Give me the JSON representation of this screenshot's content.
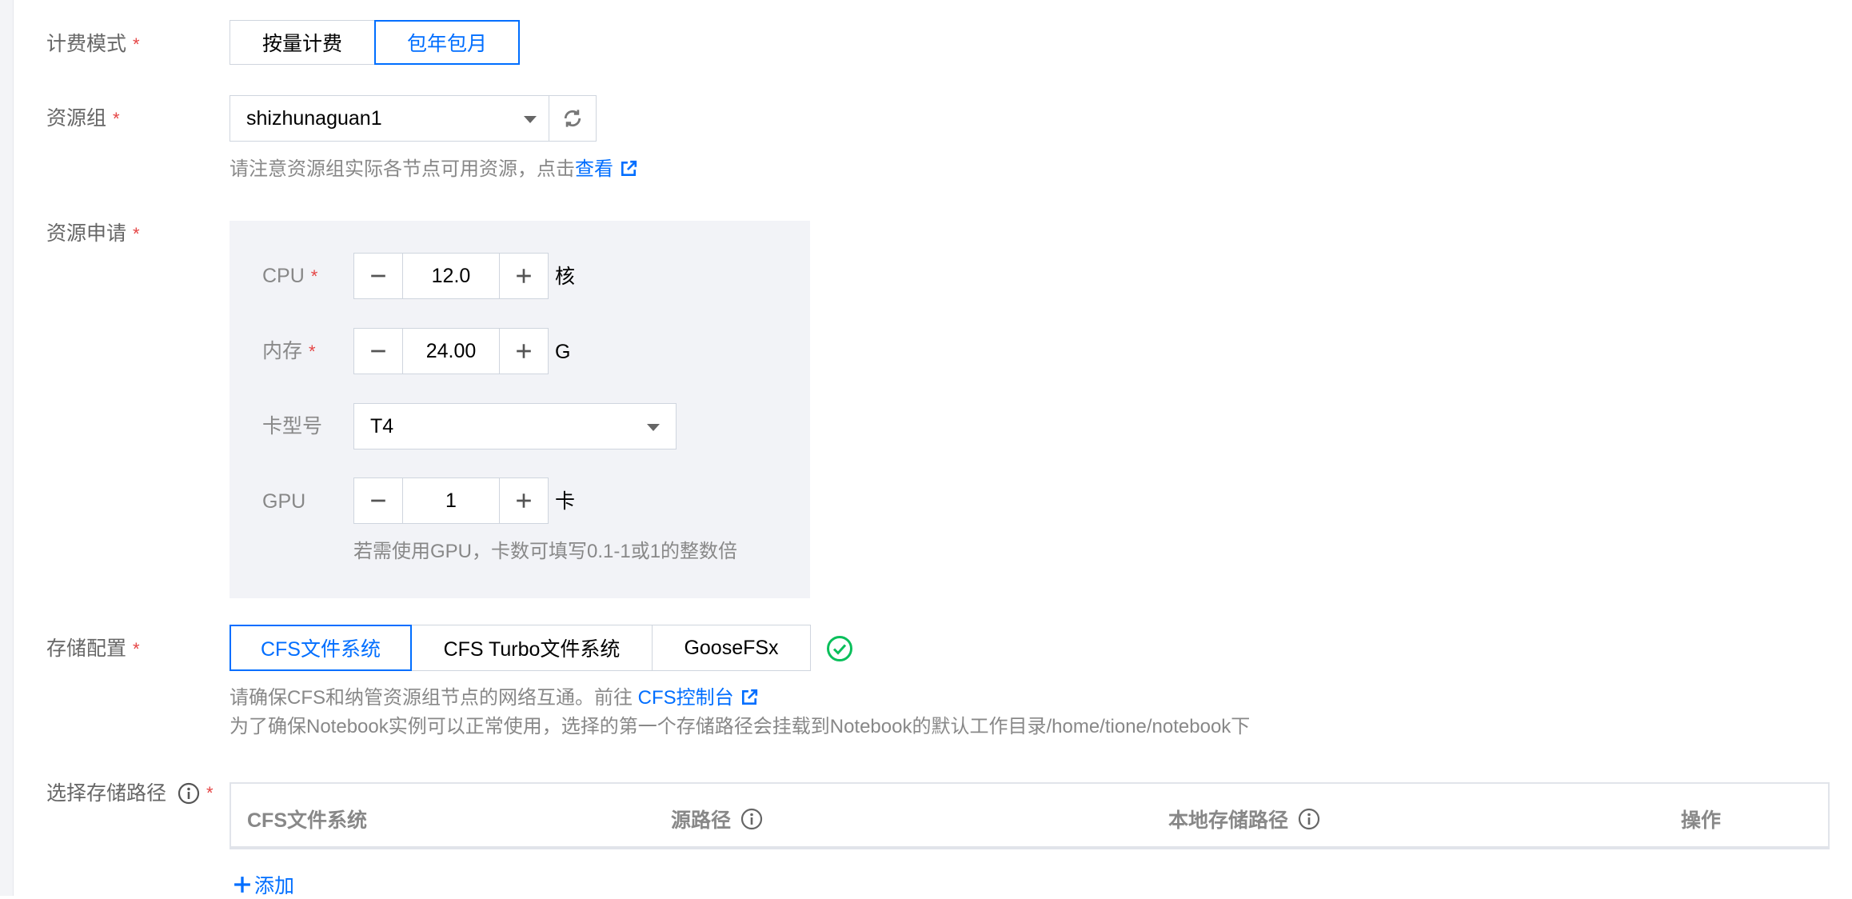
{
  "billing": {
    "label": "计费模式",
    "options": [
      "按量计费",
      "包年包月"
    ],
    "selected": "包年包月"
  },
  "resource_group": {
    "label": "资源组",
    "value": "shizhunaguan1",
    "hint": "请注意资源组实际各节点可用资源，点击",
    "hint_link": "查看"
  },
  "resource_request": {
    "label": "资源申请",
    "cpu": {
      "label": "CPU",
      "value": "12.0",
      "unit": "核"
    },
    "memory": {
      "label": "内存",
      "value": "24.00",
      "unit": "G"
    },
    "card_type": {
      "label": "卡型号",
      "value": "T4"
    },
    "gpu": {
      "label": "GPU",
      "value": "1",
      "unit": "卡"
    },
    "gpu_hint": "若需使用GPU，卡数可填写0.1-1或1的整数倍"
  },
  "storage": {
    "label": "存储配置",
    "options": [
      "CFS文件系统",
      "CFS Turbo文件系统",
      "GooseFSx"
    ],
    "selected": "CFS文件系统",
    "hint1": "请确保CFS和纳管资源组节点的网络互通。前往 ",
    "hint1_link": "CFS控制台",
    "hint2": "为了确保Notebook实例可以正常使用，选择的第一个存储路径会挂载到Notebook的默认工作目录/home/tione/notebook下"
  },
  "storage_path": {
    "label": "选择存储路径",
    "columns": [
      "CFS文件系统",
      "源路径",
      "本地存储路径",
      "操作"
    ],
    "add_label": "添加"
  },
  "colors": {
    "accent": "#006eff",
    "required": "#e54545",
    "success": "#0abf5b"
  },
  "icons": [
    "caret-down-icon",
    "refresh-icon",
    "external-link-icon",
    "minus-icon",
    "plus-icon",
    "check-circle-icon",
    "info-icon",
    "add-icon"
  ]
}
